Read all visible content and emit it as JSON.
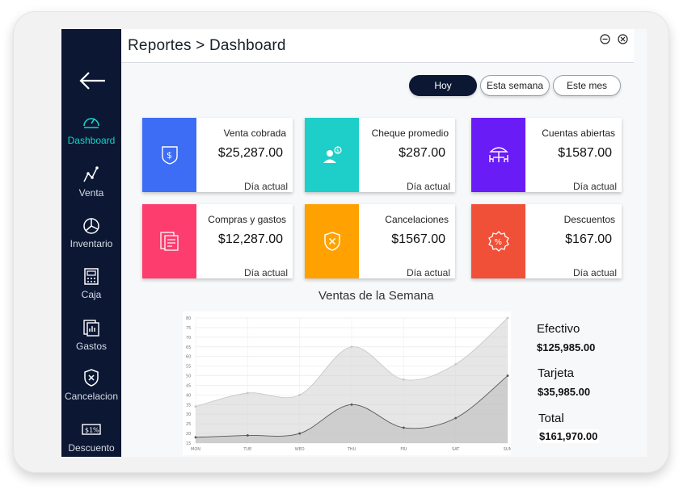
{
  "header": {
    "title": "Reportes > Dashboard"
  },
  "sidebar": {
    "back_icon": "arrow-left-icon",
    "items": [
      {
        "label": "Dashboard",
        "icon": "gauge-icon",
        "active": true
      },
      {
        "label": "Venta",
        "icon": "trend-line-icon"
      },
      {
        "label": "Inventario",
        "icon": "pie-chart-icon"
      },
      {
        "label": "Caja",
        "icon": "cash-register-icon"
      },
      {
        "label": "Gastos",
        "icon": "receipt-icon"
      },
      {
        "label": "Cancelacion",
        "icon": "shield-x-icon"
      },
      {
        "label": "Descuento",
        "icon": "discount-tag-icon"
      }
    ]
  },
  "filters": [
    {
      "label": "Hoy",
      "active": true
    },
    {
      "label": "Esta semana",
      "active": false
    },
    {
      "label": "Este mes",
      "active": false
    }
  ],
  "cards": [
    {
      "label": "Venta cobrada",
      "value": "$25,287.00",
      "sub": "Día actual",
      "color": "#3d6cf5",
      "icon": "dollar-shield-icon"
    },
    {
      "label": "Cheque promedio",
      "value": "$287.00",
      "sub": "Día actual",
      "color": "#1dcfc8",
      "icon": "user-coin-icon"
    },
    {
      "label": "Cuentas abiertas",
      "value": "$1587.00",
      "sub": "Día actual",
      "color": "#6a1cf7",
      "icon": "table-umbrella-icon"
    },
    {
      "label": "Compras y gastos",
      "value": "$12,287.00",
      "sub": "Día actual",
      "color": "#fc3d6e",
      "icon": "receipts-icon"
    },
    {
      "label": "Cancelaciones",
      "value": "$1567.00",
      "sub": "Día actual",
      "color": "#ffa201",
      "icon": "shield-x-icon"
    },
    {
      "label": "Descuentos",
      "value": "$167.00",
      "sub": "Día actual",
      "color": "#f05038",
      "icon": "percent-badge-icon"
    }
  ],
  "legend": [
    {
      "label": "Efectivo",
      "value": "$125,985.00"
    },
    {
      "label": "Tarjeta",
      "value": "$35,985.00"
    },
    {
      "label": "Total",
      "value": "$161,970.00"
    }
  ],
  "chart_data": {
    "type": "area",
    "title": "Ventas de la Semana",
    "categories": [
      "MON",
      "TUE",
      "WED",
      "THU",
      "FRI",
      "SAT",
      "SUN"
    ],
    "series": [
      {
        "values": [
          34,
          41,
          40,
          65,
          48,
          56,
          80
        ],
        "color": "#c8c8c8"
      },
      {
        "values": [
          18,
          19,
          20,
          35,
          23,
          28,
          50
        ],
        "color": "#555555"
      }
    ],
    "ylim": [
      15,
      80
    ],
    "yticks": [
      15,
      20,
      25,
      30,
      35,
      40,
      45,
      50,
      55,
      60,
      65,
      70,
      75,
      80
    ],
    "grid": true
  }
}
